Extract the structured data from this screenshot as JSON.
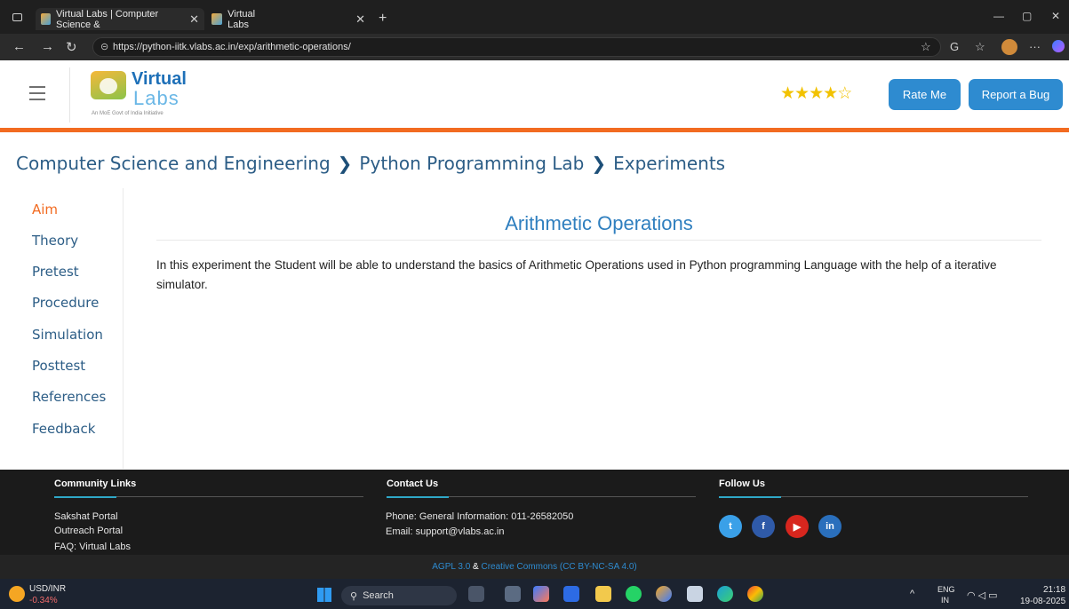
{
  "browser": {
    "tabs": [
      {
        "label": "Virtual Labs | Computer Science &"
      },
      {
        "label": "Virtual Labs"
      }
    ],
    "url": "https://python-iitk.vlabs.ac.in/exp/arithmetic-operations/",
    "new_tab_glyph": "+",
    "close_glyph": "✕"
  },
  "header": {
    "logo_virtual": "Virtual",
    "logo_labs": "Labs",
    "logo_tagline": "An MoE Govt of India Initiative",
    "rating_stars_filled": 4,
    "rating_stars_total": 5,
    "rate_me": "Rate Me",
    "report_bug": "Report a Bug"
  },
  "breadcrumb": {
    "items": [
      "Computer Science and Engineering",
      "Python Programming Lab",
      "Experiments"
    ],
    "separator": "❯"
  },
  "sidebar": {
    "items": [
      {
        "label": "Aim",
        "active": true
      },
      {
        "label": "Theory"
      },
      {
        "label": "Pretest"
      },
      {
        "label": "Procedure"
      },
      {
        "label": "Simulation"
      },
      {
        "label": "Posttest"
      },
      {
        "label": "References"
      },
      {
        "label": "Feedback"
      }
    ]
  },
  "main": {
    "title": "Arithmetic Operations",
    "description": "In this experiment the Student will be able to understand the basics of Arithmetic Operations used in Python programming Language with the help of a iterative simulator."
  },
  "footer": {
    "community": {
      "heading": "Community Links",
      "links": [
        "Sakshat Portal",
        "Outreach Portal",
        "FAQ: Virtual Labs"
      ]
    },
    "contact": {
      "heading": "Contact Us",
      "phone": "Phone: General Information: 011-26582050",
      "email": "Email: support@vlabs.ac.in"
    },
    "follow": {
      "heading": "Follow Us",
      "networks": [
        {
          "icon": "twitter-icon",
          "glyph": "t",
          "color": "#3aa0e8"
        },
        {
          "icon": "facebook-icon",
          "glyph": "f",
          "color": "#2f5aa8"
        },
        {
          "icon": "youtube-icon",
          "glyph": "▶",
          "color": "#d7261e"
        },
        {
          "icon": "linkedin-icon",
          "glyph": "in",
          "color": "#2a6fbc"
        }
      ]
    },
    "license": {
      "agpl": "AGPL 3.0",
      "amp": "&",
      "cc": "Creative Commons (CC BY-NC-SA 4.0)"
    }
  },
  "taskbar": {
    "ticker_label": "USD/INR",
    "ticker_change": "-0.34%",
    "search": "Search",
    "lang_top": "ENG",
    "lang_bottom": "IN",
    "time": "21:18",
    "date": "19-08-2025"
  },
  "colors": {
    "accent_orange": "#f26b21",
    "brand_blue": "#2e8bd0",
    "link_blue": "#2c5d86"
  }
}
